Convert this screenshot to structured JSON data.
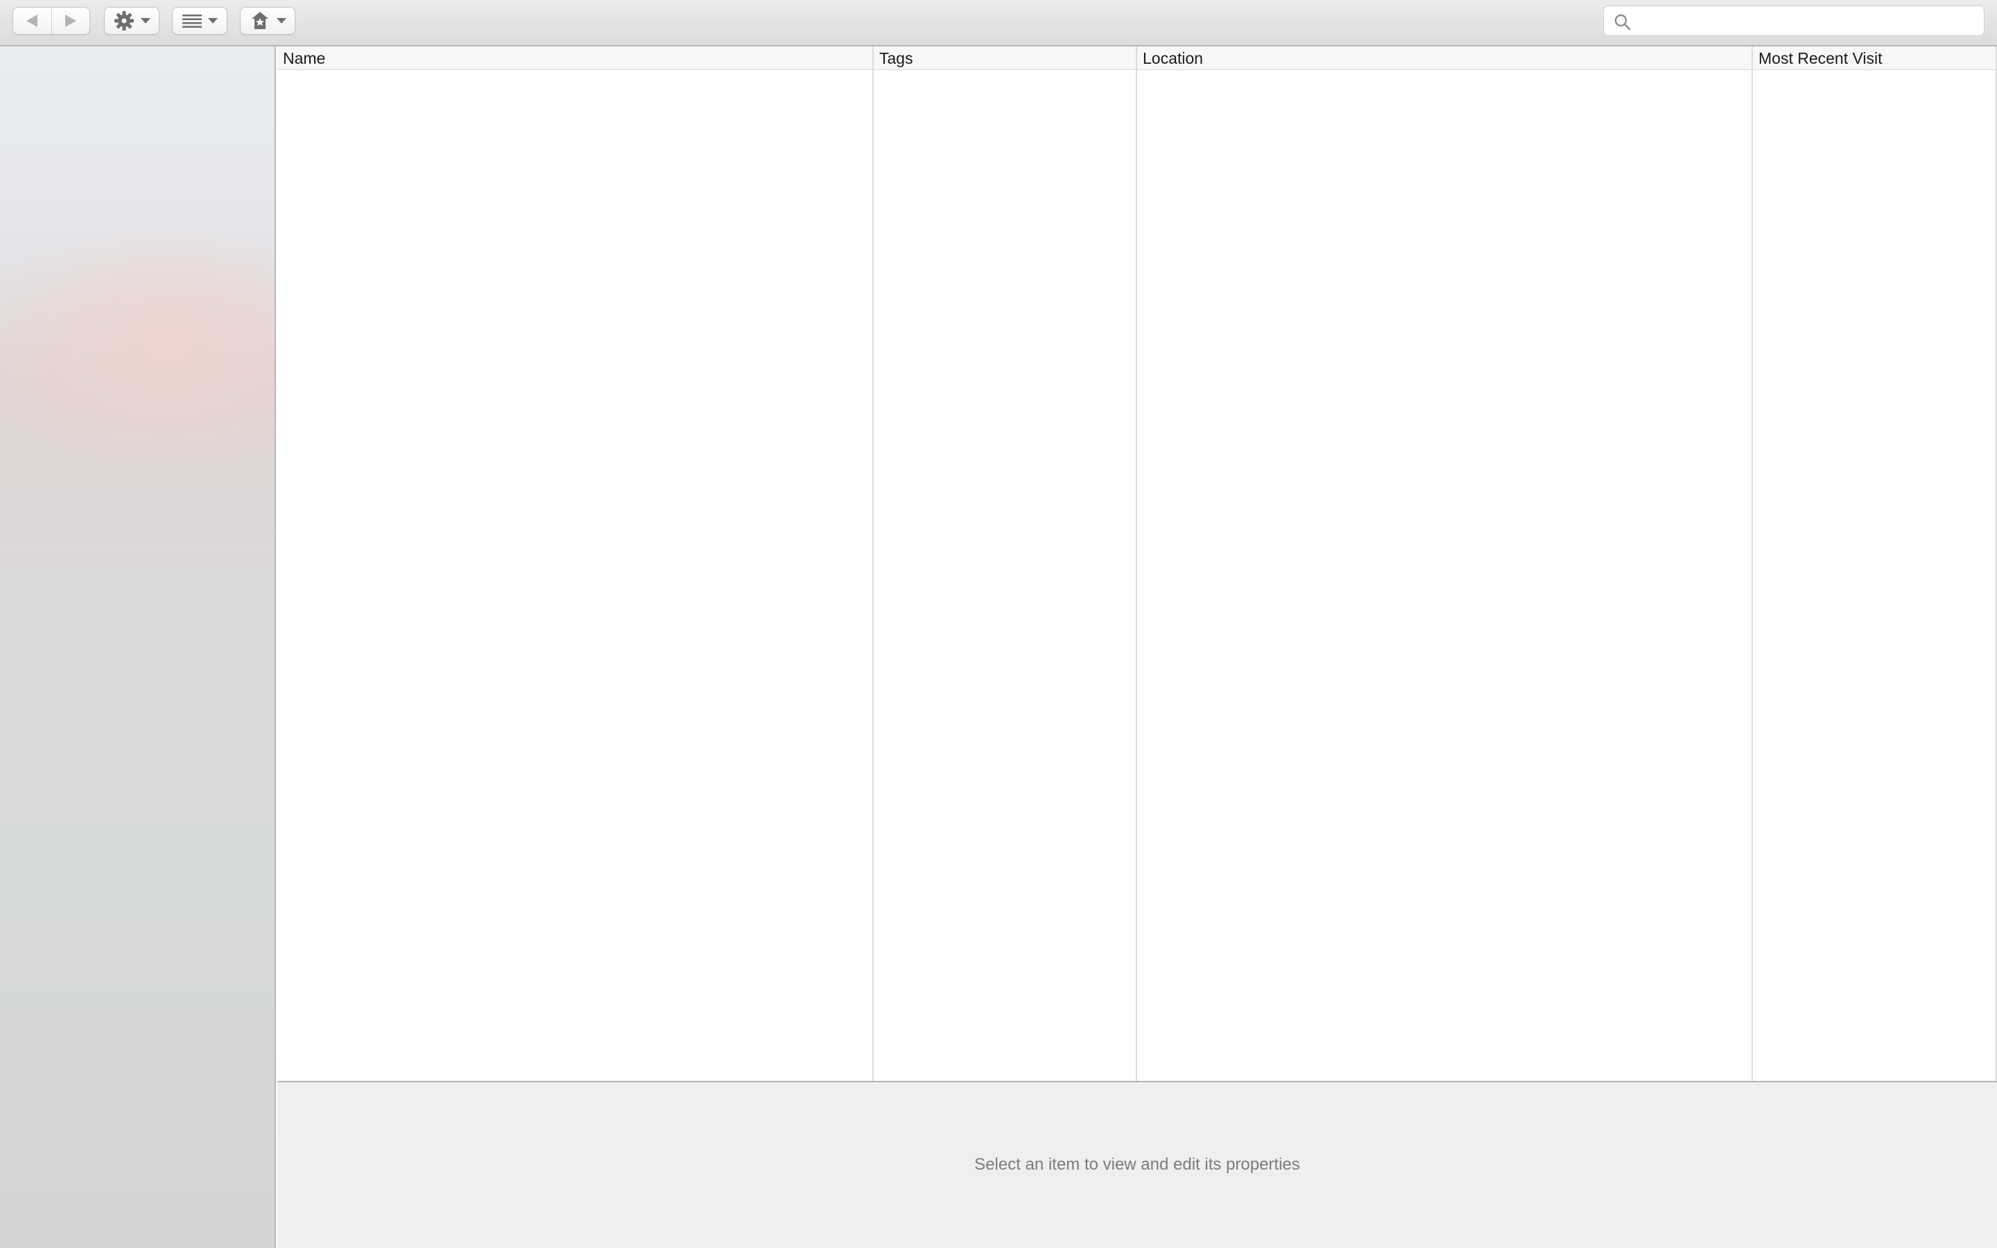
{
  "toolbar": {
    "back_icon": "back-arrow-icon",
    "forward_icon": "forward-arrow-icon",
    "gear_icon": "gear-icon",
    "view_icon": "list-view-icon",
    "bookmark_icon": "add-bookmark-icon",
    "search": {
      "value": "",
      "placeholder": ""
    }
  },
  "table": {
    "columns": [
      {
        "label": "Name"
      },
      {
        "label": "Tags"
      },
      {
        "label": "Location"
      },
      {
        "label": "Most Recent Visit"
      }
    ],
    "rows": []
  },
  "details": {
    "message": "Select an item to view and edit its properties"
  }
}
